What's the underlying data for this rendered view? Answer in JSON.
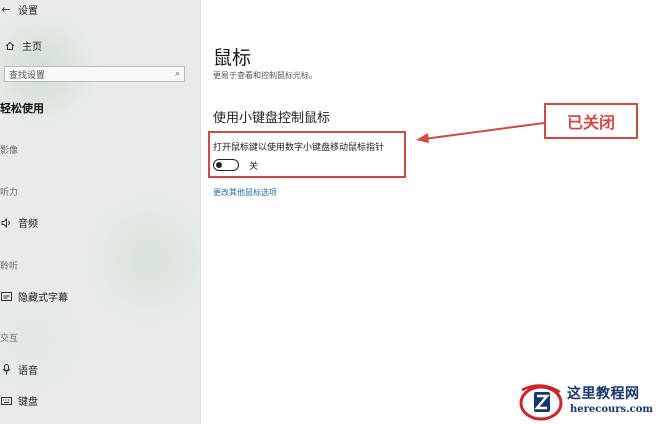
{
  "window": {
    "title": "设置"
  },
  "sidebar": {
    "home_label": "主页",
    "search_placeholder": "查找设置",
    "category": "轻松使用",
    "sections": {
      "vision": "影像",
      "hearing": "听力",
      "interaction": "交互"
    },
    "items": {
      "audio": "音频",
      "captions": "隐藏式字幕",
      "speech": "语音",
      "keyboard": "键盘"
    },
    "partial_section": "聆听"
  },
  "main": {
    "title": "鼠标",
    "subtitle": "更易于查看和控制鼠标光标。",
    "group_title": "使用小键盘控制鼠标",
    "setting_label": "打开鼠标键以使用数字小键盘移动鼠标指针",
    "toggle": {
      "state": "off",
      "state_label": "关"
    },
    "more_link": "更改其他鼠标选项"
  },
  "annotation": {
    "label": "已关闭",
    "color": "#d04a44"
  },
  "watermark": {
    "name": "这里教程网",
    "url": "herecours.com"
  },
  "colors": {
    "accent": "#1f6fb2",
    "highlight_border": "#cc4a48"
  }
}
